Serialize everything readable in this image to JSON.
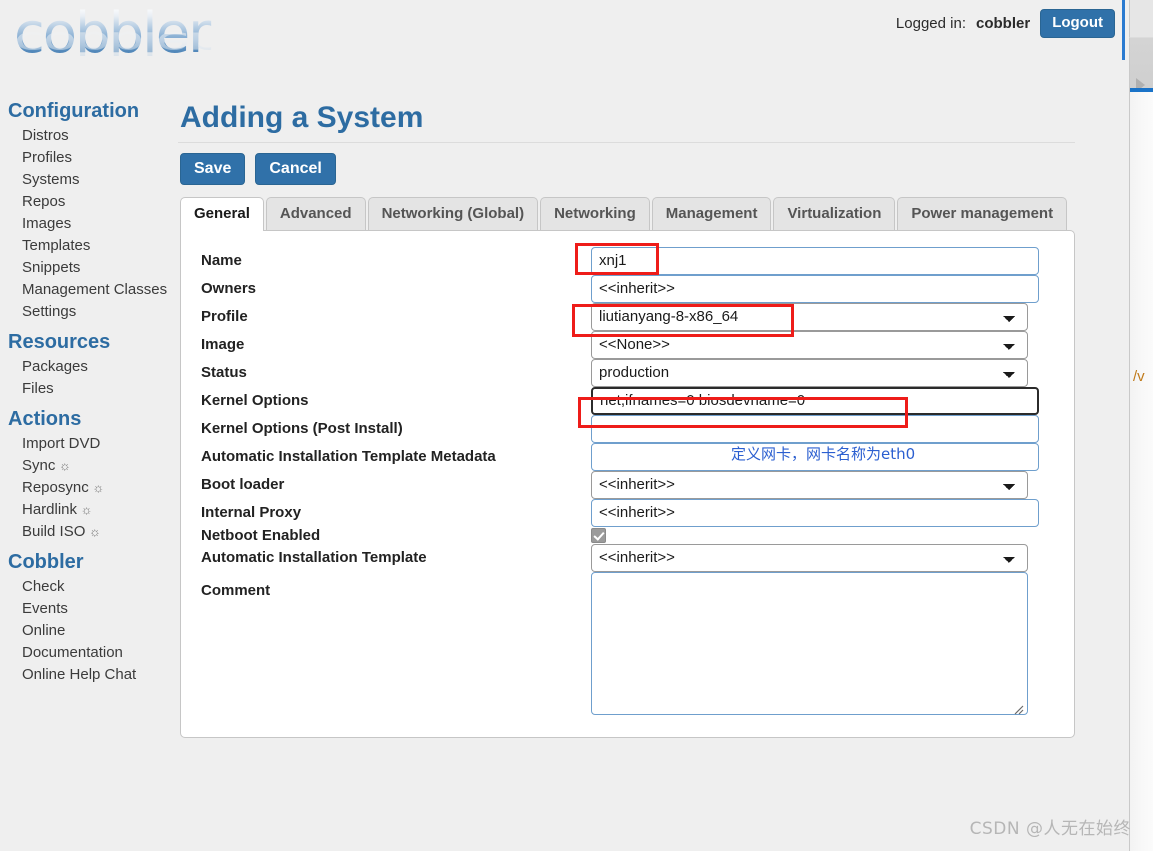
{
  "brand": {
    "logo_text": "cobbler"
  },
  "header": {
    "logged_in_label": "Logged in:",
    "username": "cobbler",
    "logout_label": "Logout"
  },
  "sidebar": {
    "groups": [
      {
        "title": "Configuration",
        "items": [
          {
            "label": "Distros",
            "icon": ""
          },
          {
            "label": "Profiles",
            "icon": ""
          },
          {
            "label": "Systems",
            "icon": ""
          },
          {
            "label": "Repos",
            "icon": ""
          },
          {
            "label": "Images",
            "icon": ""
          },
          {
            "label": "Templates",
            "icon": ""
          },
          {
            "label": "Snippets",
            "icon": ""
          },
          {
            "label": "Management Classes",
            "icon": ""
          },
          {
            "label": "Settings",
            "icon": ""
          }
        ]
      },
      {
        "title": "Resources",
        "items": [
          {
            "label": "Packages",
            "icon": ""
          },
          {
            "label": "Files",
            "icon": ""
          }
        ]
      },
      {
        "title": "Actions",
        "items": [
          {
            "label": "Import DVD",
            "icon": ""
          },
          {
            "label": "Sync",
            "icon": "☼"
          },
          {
            "label": "Reposync",
            "icon": "☼"
          },
          {
            "label": "Hardlink",
            "icon": "☼"
          },
          {
            "label": "Build ISO",
            "icon": "☼"
          }
        ]
      },
      {
        "title": "Cobbler",
        "items": [
          {
            "label": "Check",
            "icon": ""
          },
          {
            "label": "Events",
            "icon": ""
          },
          {
            "label": "Online",
            "icon": ""
          },
          {
            "label": "Documentation",
            "icon": ""
          },
          {
            "label": "Online Help Chat",
            "icon": ""
          }
        ]
      }
    ]
  },
  "main": {
    "title": "Adding a System",
    "save_label": "Save",
    "cancel_label": "Cancel",
    "tabs": [
      {
        "label": "General",
        "active": true
      },
      {
        "label": "Advanced",
        "active": false
      },
      {
        "label": "Networking (Global)",
        "active": false
      },
      {
        "label": "Networking",
        "active": false
      },
      {
        "label": "Management",
        "active": false
      },
      {
        "label": "Virtualization",
        "active": false
      },
      {
        "label": "Power management",
        "active": false
      }
    ],
    "fields": {
      "name": {
        "label": "Name",
        "value": "xnj1"
      },
      "owners": {
        "label": "Owners",
        "value": "<<inherit>>"
      },
      "profile": {
        "label": "Profile",
        "value": "liutianyang-8-x86_64"
      },
      "image": {
        "label": "Image",
        "value": "<<None>>"
      },
      "status": {
        "label": "Status",
        "value": "production"
      },
      "kernel_options": {
        "label": "Kernel Options",
        "value": "net,ifnames=0 biosdevname=0"
      },
      "kernel_options_post": {
        "label": "Kernel Options (Post Install)",
        "value": ""
      },
      "auto_install_metadata": {
        "label": "Automatic Installation Template Metadata",
        "value": ""
      },
      "boot_loader": {
        "label": "Boot loader",
        "value": "<<inherit>>"
      },
      "internal_proxy": {
        "label": "Internal Proxy",
        "value": "<<inherit>>"
      },
      "netboot_enabled": {
        "label": "Netboot Enabled",
        "checked": true
      },
      "auto_install_template": {
        "label": "Automatic Installation Template",
        "value": "<<inherit>>"
      },
      "comment": {
        "label": "Comment",
        "value": ""
      }
    }
  },
  "annotations": {
    "highlight_color": "#ee1c19",
    "note_color": "#2b5fd0",
    "note_text": "定义网卡，网卡名称为eth0"
  },
  "background_window": {
    "fragment_text": "/v"
  },
  "watermark": {
    "text": "CSDN @人无在始终"
  }
}
